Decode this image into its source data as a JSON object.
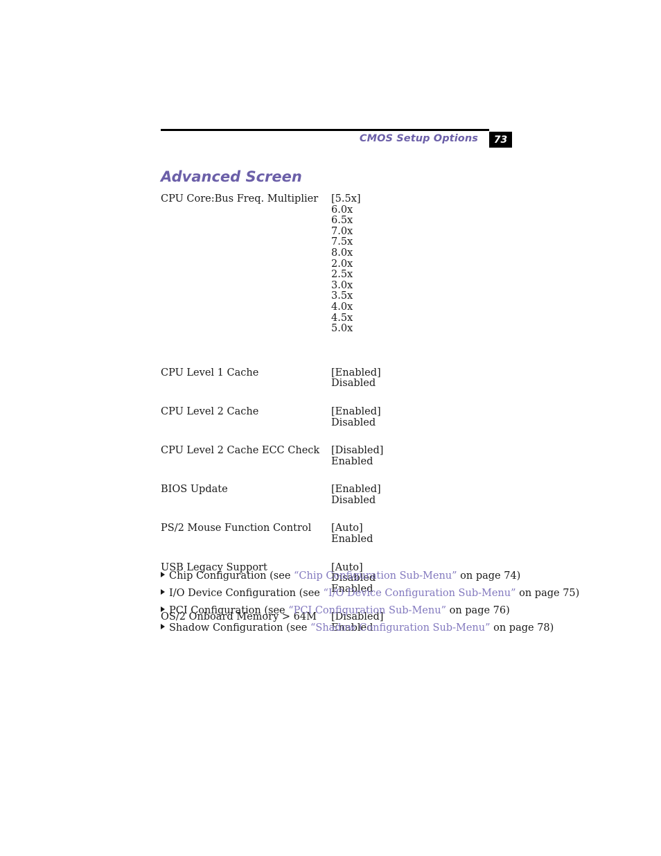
{
  "header": {
    "title": "CMOS Setup Options",
    "page_number": "73",
    "rule_color": "#000000",
    "accent_color": "#6B5FA8"
  },
  "section": {
    "heading": "Advanced Screen"
  },
  "options": [
    {
      "label": "CPU Core:Bus Freq. Multiplier",
      "values": [
        "[5.5x]",
        "6.0x",
        "6.5x",
        "7.0x",
        "7.5x",
        "8.0x",
        "2.0x",
        "2.5x",
        "3.0x",
        "3.5x",
        "4.0x",
        "4.5x",
        "5.0x"
      ]
    },
    {
      "label": "CPU Level 1 Cache",
      "values": [
        "[Enabled]",
        "Disabled"
      ]
    },
    {
      "label": "CPU Level 2 Cache",
      "values": [
        "[Enabled]",
        "Disabled"
      ]
    },
    {
      "label": "CPU Level 2 Cache ECC Check",
      "values": [
        "[Disabled]",
        "Enabled"
      ]
    },
    {
      "label": "BIOS Update",
      "values": [
        "[Enabled]",
        "Disabled"
      ]
    },
    {
      "label": "PS/2 Mouse Function Control",
      "values": [
        "[Auto]",
        "Enabled"
      ]
    },
    {
      "label": "USB Legacy Support",
      "values": [
        "[Auto]",
        "Disabled",
        "Enabled"
      ]
    },
    {
      "label": "OS/2 Onboard Memory > 64M",
      "values": [
        "[Disabled]",
        "Enabled"
      ]
    }
  ],
  "cross_references": [
    {
      "prefix": "Chip Configuration (see ",
      "link": "“Chip Configuration Sub-Menu”",
      "suffix": " on page 74)"
    },
    {
      "prefix": "I/O Device Configuration (see ",
      "link": "“I/O Device Configuration Sub-Menu”",
      "suffix": " on page 75)"
    },
    {
      "prefix": "PCI Configuration (see ",
      "link": "“PCI Configuration Sub-Menu”",
      "suffix": " on page 76)"
    },
    {
      "prefix": "Shadow Configuration (see ",
      "link": "“Shadow Configuration Sub-Menu”",
      "suffix": " on page 78)"
    }
  ],
  "link_color": "#8278BE"
}
